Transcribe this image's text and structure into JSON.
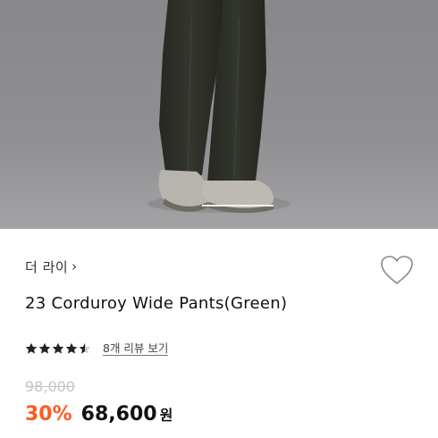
{
  "product": {
    "brand": "더 라이",
    "title": "23 Corduroy Wide Pants(Green)",
    "rating": 4.5,
    "rating_max": 5,
    "review_label": "8개 리뷰 보기",
    "original_price": "98,000",
    "discount_rate": "30%",
    "sale_price": "68,600",
    "currency": "원"
  },
  "icons": {
    "brand_link": "chevron-right-icon",
    "wishlist": "heart-outline-icon",
    "star": "star-icon"
  },
  "colors": {
    "discount": "#ff5a1f",
    "original_price": "#c4c4c4",
    "star": "#222222"
  }
}
